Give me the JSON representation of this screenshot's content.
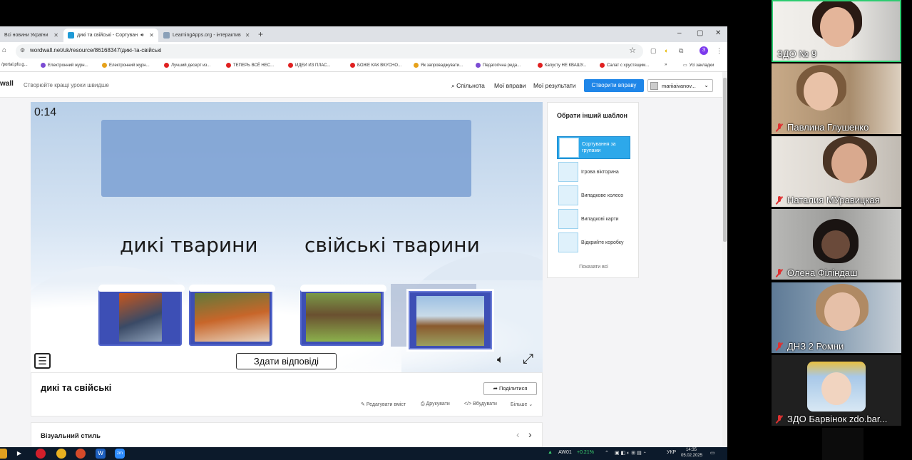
{
  "browser": {
    "tabs": [
      {
        "label": "Всі новини України",
        "active": false
      },
      {
        "label": "дикі та свійські - Сортуван",
        "active": true
      },
      {
        "label": "LearningApps.org - інтерактив",
        "active": false
      }
    ],
    "new_tab": "+",
    "window_controls": [
      "–",
      "▢",
      "✕"
    ],
    "url": "wordwall.net/uk/resource/86168347/дикі-та-свійські",
    "profile_initial": "З",
    "bookmarks": [
      {
        "label": "/portal.pfu.g...",
        "color": "#888888"
      },
      {
        "label": "Електронний журн...",
        "color": "#7b4bd3"
      },
      {
        "label": "Електронний журн...",
        "color": "#e6a11a"
      },
      {
        "label": "Лучший десерт из...",
        "color": "#e02020"
      },
      {
        "label": "ТЕПЕРЬ ВСЁ НЕС...",
        "color": "#e02020"
      },
      {
        "label": "ИДЕИ ИЗ ПЛАС...",
        "color": "#e02020"
      },
      {
        "label": "БОЖЕ КАК ВКУСНО...",
        "color": "#e02020"
      },
      {
        "label": "Як запроваджувати...",
        "color": "#e6a11a"
      },
      {
        "label": "Педагогічна реда...",
        "color": "#7b4bd3"
      },
      {
        "label": "Капусту НЕ КВАШУ...",
        "color": "#e02020"
      },
      {
        "label": "Салат с хрустящим...",
        "color": "#e02020"
      }
    ],
    "bookmarks_more": "»",
    "all_bookmarks": "Усі закладки"
  },
  "header": {
    "logo": "wall",
    "tagline": "Створюйте кращі уроки швидше",
    "nav": [
      "Спільнота",
      "Мої вправи",
      "Мої результати"
    ],
    "create_label": "Створити вправу",
    "user_name": "mariiaivanov..."
  },
  "game": {
    "timer": "0:14",
    "group_left": "дикі тварини",
    "group_right": "свійські тварини",
    "cards": [
      {
        "name": "wolf",
        "color": "#5a6a80"
      },
      {
        "name": "fox",
        "color": "#c8662a"
      },
      {
        "name": "dog",
        "color": "#6d8a3a"
      },
      {
        "name": "horse",
        "color": "#8a5a2e"
      }
    ],
    "submit_label": "Здати відповіді"
  },
  "templates": {
    "title": "Обрати інший шаблон",
    "items": [
      {
        "label": "Сортування за групами",
        "selected": true
      },
      {
        "label": "Ігрова вікторина",
        "selected": false
      },
      {
        "label": "Випадкове колесо",
        "selected": false
      },
      {
        "label": "Випадкові карти",
        "selected": false
      },
      {
        "label": "Відкрийте коробку",
        "selected": false
      }
    ],
    "show_all": "Показати всі"
  },
  "activity": {
    "title": "дикі та свійські",
    "share_label": "Поділитися",
    "links": [
      "Редагувати вміст",
      "Друкувати",
      "Вбудувати",
      "Більше"
    ],
    "visual_style_label": "Візуальний стиль"
  },
  "taskbar": {
    "ticker": "AW01",
    "change": "+0.21%",
    "lang": "УКР",
    "time": "14:35",
    "date": "05.02.2025"
  },
  "participants": [
    {
      "name": "ЗДО № 9",
      "muted": false,
      "speaking": true,
      "bg": "#e8e6e2",
      "skin": "#e4b59a",
      "hair": "#2a1a14"
    },
    {
      "name": "Павлина Глушенко",
      "muted": true,
      "speaking": false,
      "bg": "#b49a7c",
      "skin": "#e9c2a8",
      "hair": "#7a5a3c"
    },
    {
      "name": "Наталия МУравицкая",
      "muted": true,
      "speaking": false,
      "bg": "#d8d3cc",
      "skin": "#d9a98e",
      "hair": "#4a3424"
    },
    {
      "name": "Олена Філіндаш",
      "muted": true,
      "speaking": false,
      "bg": "#a6a6a4",
      "skin": "#6a4a3a",
      "hair": "#1a1412"
    },
    {
      "name": "ДНЗ 2 Ромни",
      "muted": true,
      "speaking": false,
      "bg": "#7f95a8",
      "skin": "#e6c0a8",
      "hair": "#b08a64"
    },
    {
      "name": "ЗДО Барвінок zdo.bar...",
      "muted": true,
      "speaking": false,
      "bg": "#2f2f2f",
      "skin": "#f1d4c0",
      "hair": "#c9a27a"
    }
  ]
}
